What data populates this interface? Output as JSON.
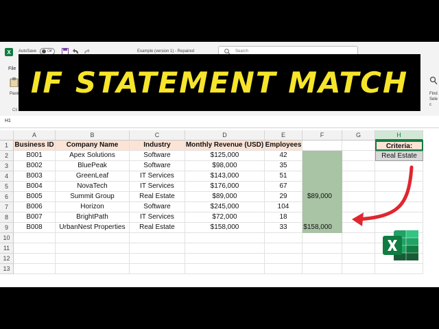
{
  "titlebar": {
    "autosave_label": "AutoSave",
    "autosave_state": "Off",
    "doc_title": "Example (version 1) - Repaired",
    "search_placeholder": "Search"
  },
  "ribbon": {
    "file_tab": "File",
    "paste_label": "Paste",
    "clipboard_label": "Cli",
    "find_select_label": "Find Selec"
  },
  "banner": {
    "text": "IF STATEMENT MATCH",
    "color": "#f6e52a"
  },
  "namebox": {
    "value": "H1"
  },
  "grid": {
    "columns": [
      "A",
      "B",
      "C",
      "D",
      "E",
      "F",
      "G",
      "H"
    ],
    "selected_column": "H",
    "rows": [
      "1",
      "2",
      "3",
      "4",
      "5",
      "6",
      "7",
      "8",
      "9",
      "10",
      "11",
      "12",
      "13"
    ],
    "headers": [
      "Business ID",
      "Company Name",
      "Industry",
      "Monthly Revenue (USD)",
      "Employees"
    ],
    "data": [
      [
        "B001",
        "Apex Solutions",
        "Software",
        "$125,000",
        "42"
      ],
      [
        "B002",
        "BluePeak",
        "Software",
        "$98,000",
        "35"
      ],
      [
        "B003",
        "GreenLeaf",
        "IT Services",
        "$143,000",
        "51"
      ],
      [
        "B004",
        "NovaTech",
        "IT Services",
        "$176,000",
        "67"
      ],
      [
        "B005",
        "Summit Group",
        "Real Estate",
        "$89,000",
        "29"
      ],
      [
        "B006",
        "Horizon",
        "Software",
        "$245,000",
        "104"
      ],
      [
        "B007",
        "BrightPath",
        "IT Services",
        "$72,000",
        "18"
      ],
      [
        "B008",
        "UrbanNest Properties",
        "Real Estate",
        "$158,000",
        "33"
      ]
    ],
    "f_values": [
      "",
      "",
      "",
      "",
      "$89,000",
      "",
      "",
      "$158,000"
    ],
    "criteria_label": "Criteria:",
    "criteria_value": "Real Estate"
  },
  "colors": {
    "header_fill": "#fbe3d6",
    "result_fill": "#a9c3a5",
    "arrow": "#e0262e",
    "excel_green": "#107c41"
  },
  "icons": [
    "excel-app-icon",
    "save-icon",
    "undo-icon",
    "redo-icon",
    "search-icon",
    "excel-logo"
  ]
}
